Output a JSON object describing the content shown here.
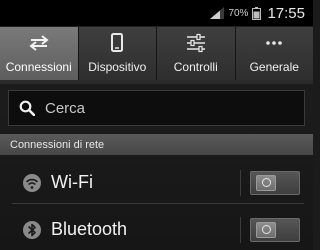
{
  "status_bar": {
    "signal_icon": "signal-icon",
    "battery_percent": "70%",
    "battery_icon": "battery-icon",
    "time": "17:55"
  },
  "tabs": [
    {
      "label": "Connessioni",
      "icon": "swap-arrows-icon",
      "active": true
    },
    {
      "label": "Dispositivo",
      "icon": "phone-icon",
      "active": false
    },
    {
      "label": "Controlli",
      "icon": "sliders-icon",
      "active": false
    },
    {
      "label": "Generale",
      "icon": "more-dots-icon",
      "active": false
    }
  ],
  "search": {
    "placeholder": "Cerca",
    "value": "",
    "icon": "search-icon"
  },
  "section": {
    "title": "Connessioni di rete"
  },
  "rows": [
    {
      "label": "Wi-Fi",
      "icon": "wifi-icon",
      "toggle_on": false
    },
    {
      "label": "Bluetooth",
      "icon": "bluetooth-icon",
      "toggle_on": false
    }
  ]
}
